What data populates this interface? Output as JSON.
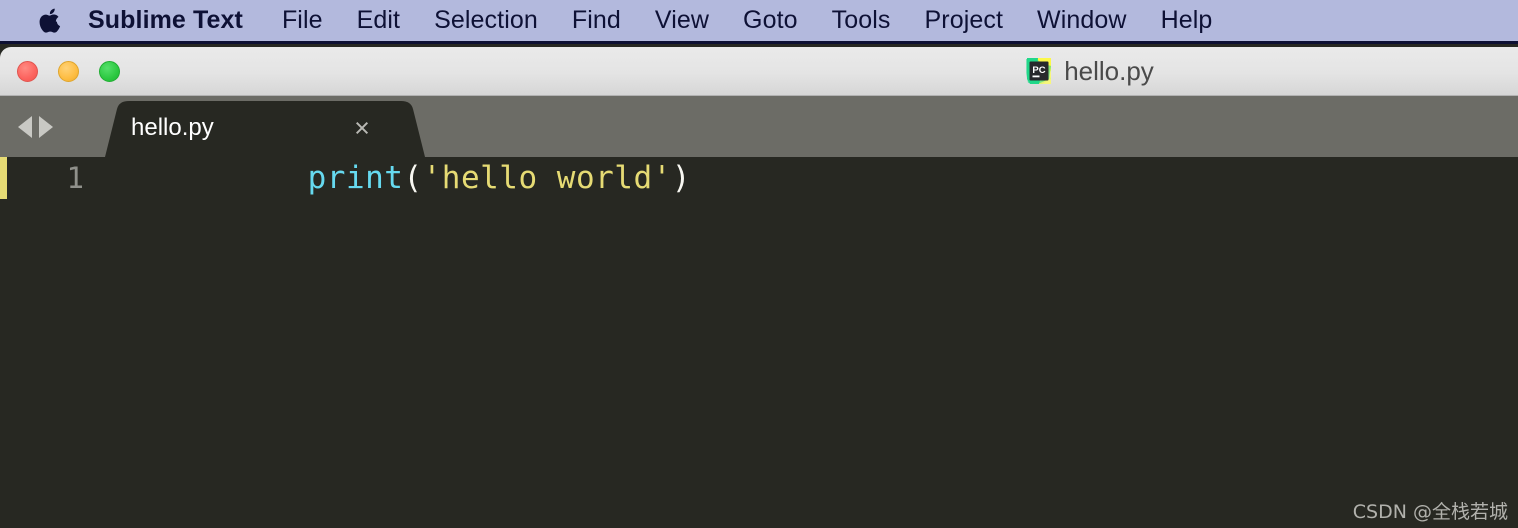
{
  "menubar": {
    "apple_icon": "apple-logo-icon",
    "items": [
      {
        "label": "Sublime Text",
        "bold": true
      },
      {
        "label": "File",
        "bold": false
      },
      {
        "label": "Edit",
        "bold": false
      },
      {
        "label": "Selection",
        "bold": false
      },
      {
        "label": "Find",
        "bold": false
      },
      {
        "label": "View",
        "bold": false
      },
      {
        "label": "Goto",
        "bold": false
      },
      {
        "label": "Tools",
        "bold": false
      },
      {
        "label": "Project",
        "bold": false
      },
      {
        "label": "Window",
        "bold": false
      },
      {
        "label": "Help",
        "bold": false
      }
    ],
    "background_color": "#b3b9dd",
    "text_color": "#0e1135"
  },
  "titlebar": {
    "document_title": "hello.py",
    "document_icon": "pycharm-icon",
    "traffic_lights": {
      "close": {
        "name": "close-window-button",
        "color": "#fc625d"
      },
      "minimize": {
        "name": "minimize-window-button",
        "color": "#fdbc40"
      },
      "maximize": {
        "name": "maximize-window-button",
        "color": "#2bc840"
      }
    }
  },
  "tabbar": {
    "nav_back_icon": "chevron-left-icon",
    "nav_forward_icon": "chevron-right-icon",
    "tabs": [
      {
        "label": "hello.py",
        "active": true,
        "close_icon": "close-icon",
        "close_glyph": "×"
      }
    ],
    "background_color": "#6c6c66"
  },
  "editor": {
    "background_color": "#272822",
    "gutter_marker_color": "#e6db74",
    "lines": [
      {
        "number": "1",
        "text": "print('hello world')",
        "tokens": [
          {
            "text": "print",
            "type": "function",
            "color": "#66d9ef"
          },
          {
            "text": "(",
            "type": "punctuation",
            "color": "#f8f8f2"
          },
          {
            "text": "'hello world'",
            "type": "string",
            "color": "#e6db74"
          },
          {
            "text": ")",
            "type": "punctuation",
            "color": "#f8f8f2"
          }
        ]
      }
    ]
  },
  "watermark": {
    "text": "CSDN @全栈若城"
  }
}
